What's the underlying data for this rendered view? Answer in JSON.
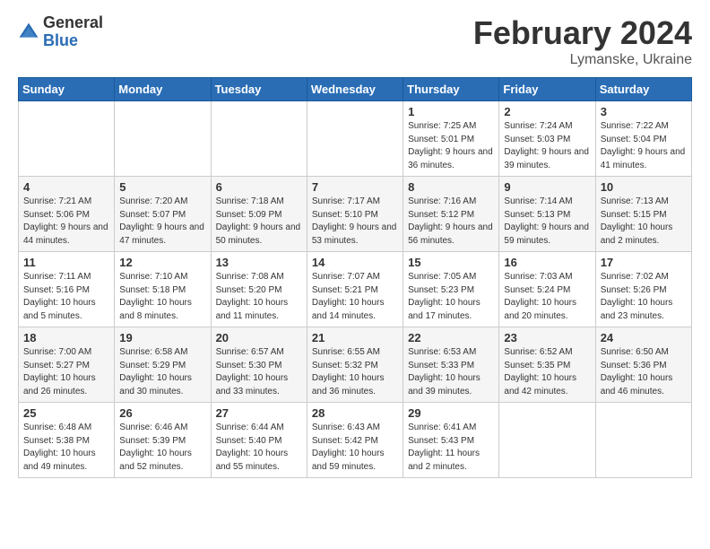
{
  "logo": {
    "general": "General",
    "blue": "Blue"
  },
  "header": {
    "month": "February 2024",
    "location": "Lymanske, Ukraine"
  },
  "weekdays": [
    "Sunday",
    "Monday",
    "Tuesday",
    "Wednesday",
    "Thursday",
    "Friday",
    "Saturday"
  ],
  "weeks": [
    [
      {
        "day": "",
        "info": ""
      },
      {
        "day": "",
        "info": ""
      },
      {
        "day": "",
        "info": ""
      },
      {
        "day": "",
        "info": ""
      },
      {
        "day": "1",
        "info": "Sunrise: 7:25 AM\nSunset: 5:01 PM\nDaylight: 9 hours\nand 36 minutes."
      },
      {
        "day": "2",
        "info": "Sunrise: 7:24 AM\nSunset: 5:03 PM\nDaylight: 9 hours\nand 39 minutes."
      },
      {
        "day": "3",
        "info": "Sunrise: 7:22 AM\nSunset: 5:04 PM\nDaylight: 9 hours\nand 41 minutes."
      }
    ],
    [
      {
        "day": "4",
        "info": "Sunrise: 7:21 AM\nSunset: 5:06 PM\nDaylight: 9 hours\nand 44 minutes."
      },
      {
        "day": "5",
        "info": "Sunrise: 7:20 AM\nSunset: 5:07 PM\nDaylight: 9 hours\nand 47 minutes."
      },
      {
        "day": "6",
        "info": "Sunrise: 7:18 AM\nSunset: 5:09 PM\nDaylight: 9 hours\nand 50 minutes."
      },
      {
        "day": "7",
        "info": "Sunrise: 7:17 AM\nSunset: 5:10 PM\nDaylight: 9 hours\nand 53 minutes."
      },
      {
        "day": "8",
        "info": "Sunrise: 7:16 AM\nSunset: 5:12 PM\nDaylight: 9 hours\nand 56 minutes."
      },
      {
        "day": "9",
        "info": "Sunrise: 7:14 AM\nSunset: 5:13 PM\nDaylight: 9 hours\nand 59 minutes."
      },
      {
        "day": "10",
        "info": "Sunrise: 7:13 AM\nSunset: 5:15 PM\nDaylight: 10 hours\nand 2 minutes."
      }
    ],
    [
      {
        "day": "11",
        "info": "Sunrise: 7:11 AM\nSunset: 5:16 PM\nDaylight: 10 hours\nand 5 minutes."
      },
      {
        "day": "12",
        "info": "Sunrise: 7:10 AM\nSunset: 5:18 PM\nDaylight: 10 hours\nand 8 minutes."
      },
      {
        "day": "13",
        "info": "Sunrise: 7:08 AM\nSunset: 5:20 PM\nDaylight: 10 hours\nand 11 minutes."
      },
      {
        "day": "14",
        "info": "Sunrise: 7:07 AM\nSunset: 5:21 PM\nDaylight: 10 hours\nand 14 minutes."
      },
      {
        "day": "15",
        "info": "Sunrise: 7:05 AM\nSunset: 5:23 PM\nDaylight: 10 hours\nand 17 minutes."
      },
      {
        "day": "16",
        "info": "Sunrise: 7:03 AM\nSunset: 5:24 PM\nDaylight: 10 hours\nand 20 minutes."
      },
      {
        "day": "17",
        "info": "Sunrise: 7:02 AM\nSunset: 5:26 PM\nDaylight: 10 hours\nand 23 minutes."
      }
    ],
    [
      {
        "day": "18",
        "info": "Sunrise: 7:00 AM\nSunset: 5:27 PM\nDaylight: 10 hours\nand 26 minutes."
      },
      {
        "day": "19",
        "info": "Sunrise: 6:58 AM\nSunset: 5:29 PM\nDaylight: 10 hours\nand 30 minutes."
      },
      {
        "day": "20",
        "info": "Sunrise: 6:57 AM\nSunset: 5:30 PM\nDaylight: 10 hours\nand 33 minutes."
      },
      {
        "day": "21",
        "info": "Sunrise: 6:55 AM\nSunset: 5:32 PM\nDaylight: 10 hours\nand 36 minutes."
      },
      {
        "day": "22",
        "info": "Sunrise: 6:53 AM\nSunset: 5:33 PM\nDaylight: 10 hours\nand 39 minutes."
      },
      {
        "day": "23",
        "info": "Sunrise: 6:52 AM\nSunset: 5:35 PM\nDaylight: 10 hours\nand 42 minutes."
      },
      {
        "day": "24",
        "info": "Sunrise: 6:50 AM\nSunset: 5:36 PM\nDaylight: 10 hours\nand 46 minutes."
      }
    ],
    [
      {
        "day": "25",
        "info": "Sunrise: 6:48 AM\nSunset: 5:38 PM\nDaylight: 10 hours\nand 49 minutes."
      },
      {
        "day": "26",
        "info": "Sunrise: 6:46 AM\nSunset: 5:39 PM\nDaylight: 10 hours\nand 52 minutes."
      },
      {
        "day": "27",
        "info": "Sunrise: 6:44 AM\nSunset: 5:40 PM\nDaylight: 10 hours\nand 55 minutes."
      },
      {
        "day": "28",
        "info": "Sunrise: 6:43 AM\nSunset: 5:42 PM\nDaylight: 10 hours\nand 59 minutes."
      },
      {
        "day": "29",
        "info": "Sunrise: 6:41 AM\nSunset: 5:43 PM\nDaylight: 11 hours\nand 2 minutes."
      },
      {
        "day": "",
        "info": ""
      },
      {
        "day": "",
        "info": ""
      }
    ]
  ]
}
